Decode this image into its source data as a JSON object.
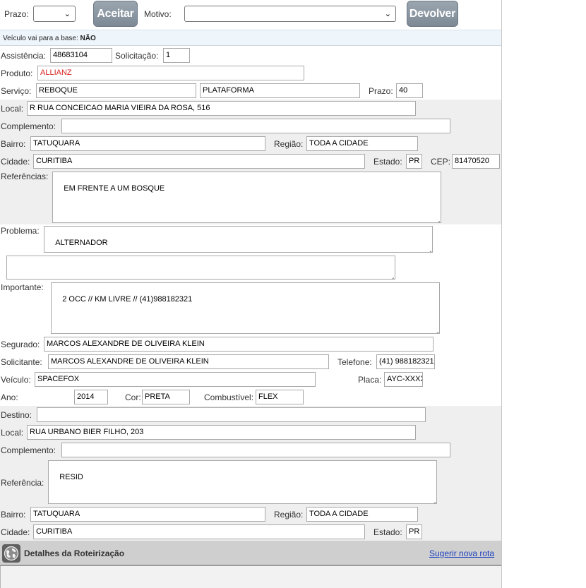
{
  "top": {
    "prazo_label": "Prazo:",
    "aceitar_label": "Aceitar",
    "motivo_label": "Motivo:",
    "devolver_label": "Devolver"
  },
  "notice": {
    "prefix": "Veículo vai para a base: ",
    "value": "NÃO"
  },
  "fields": {
    "assistencia_label": "Assistência:",
    "assistencia": "48683104",
    "solicitacao_label": "Solicitação:",
    "solicitacao": "1",
    "produto_label": "Produto:",
    "produto": "ALLIANZ",
    "servico_label": "Serviço:",
    "servico1": "REBOQUE",
    "servico2": "PLATAFORMA",
    "prazo_label": "Prazo:",
    "prazo": "40",
    "local_label": "Local:",
    "local": "R RUA CONCEICAO MARIA VIEIRA DA ROSA, 516",
    "complemento_label": "Complemento:",
    "complemento": "",
    "bairro_label": "Bairro:",
    "bairro": "TATUQUARA",
    "regiao_label": "Região:",
    "regiao": "TODA A CIDADE",
    "cidade_label": "Cidade:",
    "cidade": "CURITIBA",
    "estado_label": "Estado:",
    "estado": "PR",
    "cep_label": "CEP:",
    "cep": "81470520",
    "referencias_label": "Referências:",
    "referencias": "EM FRENTE A UM BOSQUE",
    "problema_label": "Problema:",
    "problema": "ALTERNADOR",
    "problema_extra": "",
    "importante_label": "Importante:",
    "importante": "2 OCC // KM LIVRE // (41)988182321",
    "segurado_label": "Segurado:",
    "segurado": "MARCOS ALEXANDRE DE OLIVEIRA KLEIN",
    "solicitante_label": "Solicitante:",
    "solicitante": "MARCOS ALEXANDRE DE OLIVEIRA KLEIN",
    "telefone_label": "Telefone:",
    "telefone": "(41) 988182321",
    "veiculo_label": "Veículo:",
    "veiculo": "SPACEFOX",
    "placa_label": "Placa:",
    "placa": "AYC-XXXX",
    "ano_label": "Ano:",
    "ano": "2014",
    "cor_label": "Cor:",
    "cor": "PRETA",
    "combustivel_label": "Combustível:",
    "combustivel": "FLEX"
  },
  "destino": {
    "destino_label": "Destino:",
    "destino": "",
    "local_label": "Local:",
    "local": "RUA URBANO BIER FILHO, 203",
    "complemento_label": "Complemento:",
    "complemento": "",
    "referencia_label": "Referência:",
    "referencia": "RESID",
    "bairro_label": "Bairro:",
    "bairro": "TATUQUARA",
    "regiao_label": "Região:",
    "regiao": "TODA A CIDADE",
    "cidade_label": "Cidade:",
    "cidade": "CURITIBA",
    "estado_label": "Estado:",
    "estado": "PR"
  },
  "rota": {
    "title": "Detalhes da Roteirização",
    "link": "Sugerir nova rota",
    "icon": "globe-icon"
  }
}
